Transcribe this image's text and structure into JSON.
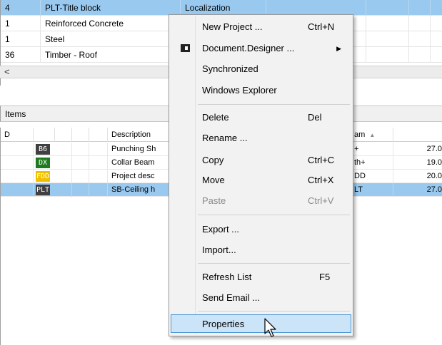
{
  "top_grid": {
    "rows": [
      {
        "count": "4",
        "name": "PLT-Title block",
        "extra": "Localization",
        "selected": true
      },
      {
        "count": "1",
        "name": "Reinforced Concrete",
        "extra": "",
        "selected": false
      },
      {
        "count": "1",
        "name": "Steel",
        "extra": "",
        "selected": false
      },
      {
        "count": "36",
        "name": "Timber - Roof",
        "extra": "",
        "selected": false
      }
    ],
    "scroll_left_glyph": "<"
  },
  "items_panel": {
    "title": "Items",
    "headers": {
      "d": "D",
      "description": "Description",
      "team": "am",
      "sort_glyph": "▲"
    },
    "rows": [
      {
        "badge": "B6",
        "badge_style": "dark",
        "description": "Punching Sh",
        "team": "+",
        "value": "27.0",
        "selected": false
      },
      {
        "badge": "DX",
        "badge_style": "green",
        "description": "Collar Beam",
        "team": "th+",
        "value": "19.0",
        "selected": false
      },
      {
        "badge": "FDD",
        "badge_style": "yellow",
        "description": "Project desc",
        "team": "DD",
        "value": "20.0",
        "selected": false
      },
      {
        "badge": "PLT",
        "badge_style": "dark",
        "description": "SB-Ceiling h",
        "team": "LT",
        "value": "27.0",
        "selected": true
      }
    ]
  },
  "context_menu": {
    "items": [
      {
        "label": "New Project ...",
        "shortcut": "Ctrl+N"
      },
      {
        "label": "Document.Designer ...",
        "submenu_glyph": "▶",
        "icon": "document-designer-icon"
      },
      {
        "label": "Synchronized"
      },
      {
        "label": "Windows Explorer"
      },
      {
        "label": "Delete",
        "shortcut": "Del"
      },
      {
        "label": "Rename ..."
      },
      {
        "label": "Copy",
        "shortcut": "Ctrl+C"
      },
      {
        "label": "Move",
        "shortcut": "Ctrl+X"
      },
      {
        "label": "Paste",
        "shortcut": "Ctrl+V",
        "disabled": true
      },
      {
        "label": "Export ..."
      },
      {
        "label": "Import..."
      },
      {
        "label": "Refresh List",
        "shortcut": "F5"
      },
      {
        "label": "Send Email ..."
      },
      {
        "label": "Properties",
        "hovered": true
      }
    ]
  },
  "colors": {
    "selection": "#99c9ef",
    "menu_hover": "#cce4f7",
    "menu_hover_border": "#4d97d4",
    "badge_green": "#1e7a1e",
    "badge_yellow": "#f0c000",
    "badge_dark": "#404040"
  }
}
